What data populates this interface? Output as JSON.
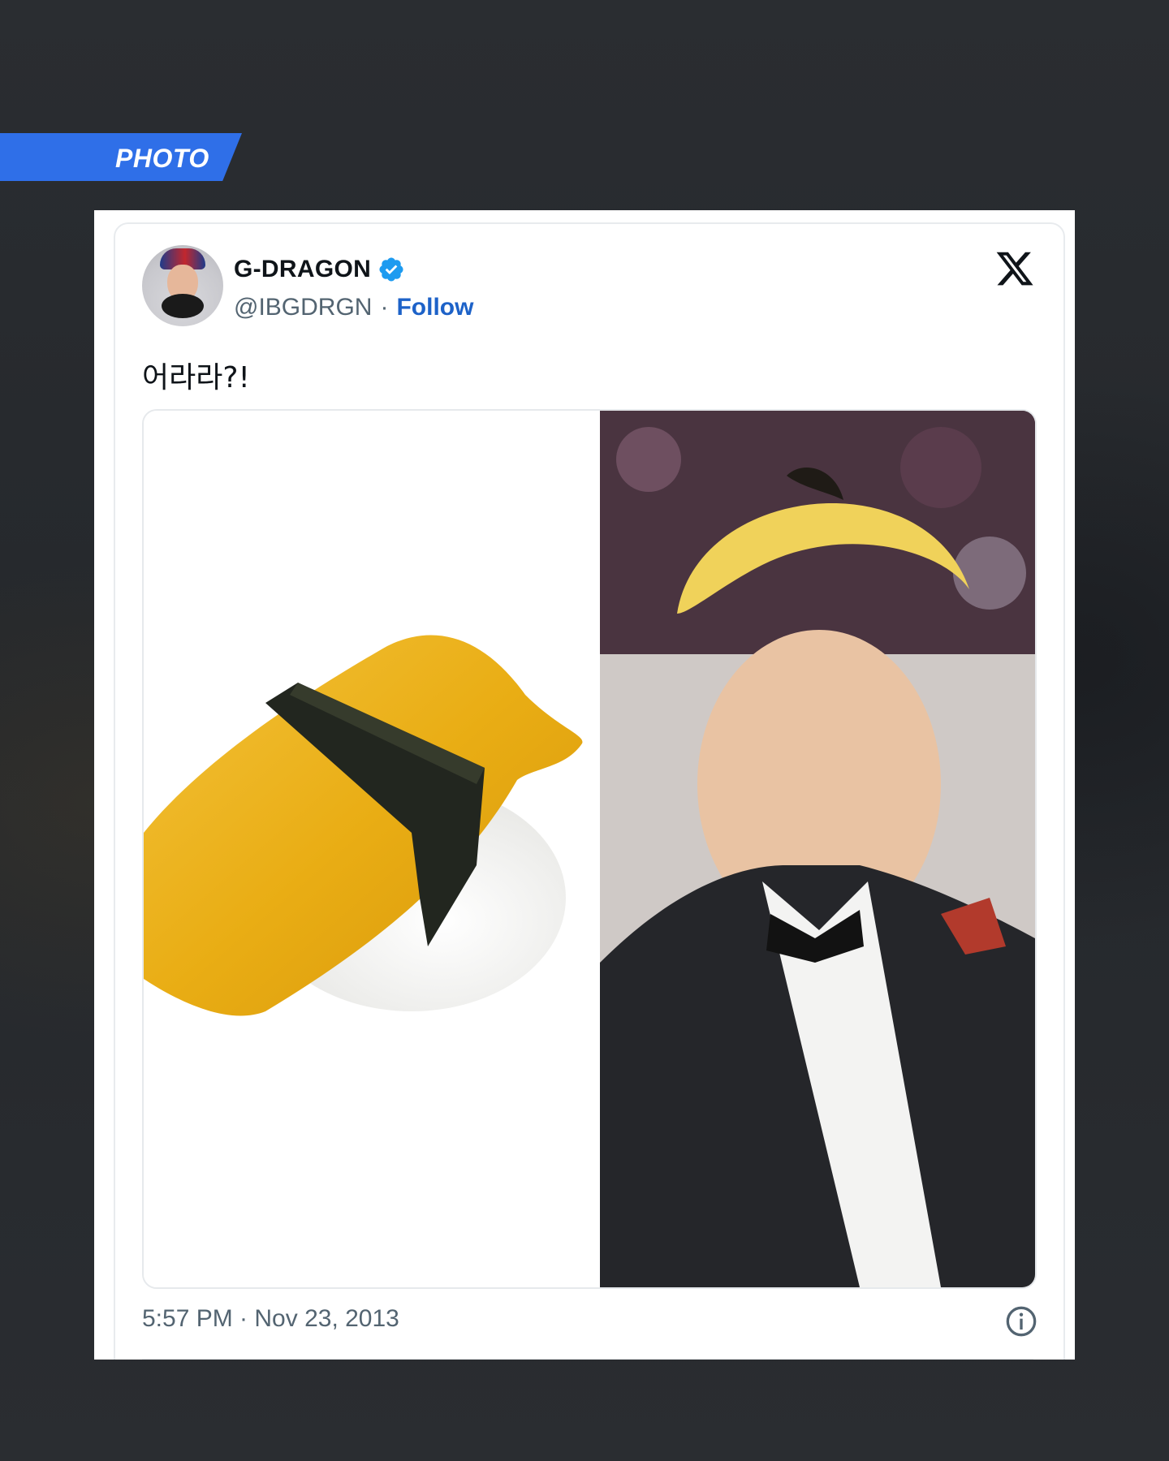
{
  "label": {
    "text": "PHOTO",
    "color": "#2f6fe8"
  },
  "tweet": {
    "display_name": "G-DRAGON",
    "verified_icon": "verified-badge-icon",
    "handle": "@IBGDRGN",
    "separator": "·",
    "follow_label": "Follow",
    "platform_icon": "x-logo-icon",
    "text": "어라라?!",
    "timestamp": "5:57 PM · Nov 23, 2013",
    "info_icon": "info-icon"
  },
  "media": {
    "left_image": "tamago-nigiri-sushi-photo",
    "right_image": "man-with-yellow-hair-in-tuxedo-photo"
  },
  "colors": {
    "accent": "#1d62c8",
    "verified": "#1d9bf0",
    "text": "#0f1419",
    "muted": "#536471",
    "background": "#2a2d31"
  }
}
